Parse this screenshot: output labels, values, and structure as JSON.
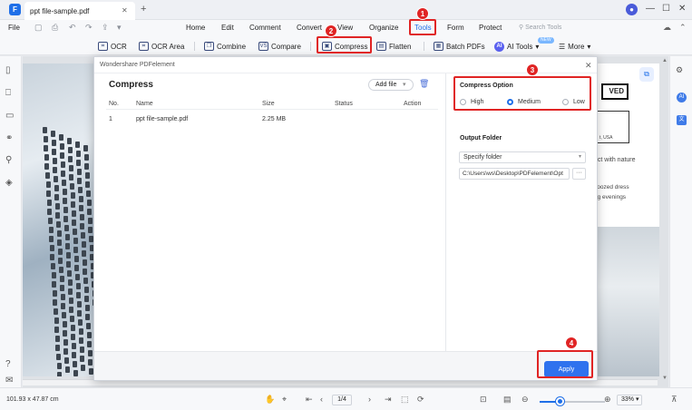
{
  "titlebar": {
    "tab_label": "ppt file-sample.pdf",
    "close_glyph": "✕",
    "add_glyph": "+",
    "app_logo_glyph": "F"
  },
  "menu": {
    "file": "File",
    "items": [
      "Home",
      "Edit",
      "Comment",
      "Convert",
      "View",
      "Organize",
      "Tools",
      "Form",
      "Protect"
    ],
    "active": "Tools",
    "search_placeholder": "Search Tools"
  },
  "toolbar": {
    "tools": [
      "OCR",
      "OCR Area",
      "Combine",
      "Compare",
      "Compress",
      "Flatten",
      "Batch PDFs",
      "AI Tools",
      "More"
    ],
    "new_tag": "NEW"
  },
  "document": {
    "right_page_logo": "VED",
    "right_page_lines": [
      "ect with nature",
      "zoozed dress",
      "ng evenings"
    ],
    "right_page_small": "t, USA"
  },
  "dialog": {
    "window_title": "Wondershare PDFelement",
    "heading": "Compress",
    "add_file_label": "Add file",
    "columns": [
      "No.",
      "Name",
      "Size",
      "Status",
      "Action"
    ],
    "rows": [
      {
        "no": "1",
        "name": "ppt file-sample.pdf",
        "size": "2.25 MB",
        "status": "",
        "action": ""
      }
    ],
    "compress_option": {
      "heading": "Compress Option",
      "options": [
        "High",
        "Medium",
        "Low"
      ],
      "selected": "Medium"
    },
    "output_folder": {
      "heading": "Output Folder",
      "select_value": "Specify folder",
      "path_value": "C:\\Users\\ws\\Desktop\\PDFelement\\Opt",
      "browse_label": "···"
    },
    "apply_label": "Apply"
  },
  "callouts": [
    "1",
    "2",
    "3",
    "4"
  ],
  "statusbar": {
    "dimensions": "101.93 x 47.87 cm",
    "page_value": "1",
    "page_total": "/4",
    "zoom": "33%",
    "zoom_fraction": 0.3
  },
  "colors": {
    "accent": "#1f6fe8",
    "callout_red": "#e02424",
    "apply_button": "#2f72ee"
  }
}
